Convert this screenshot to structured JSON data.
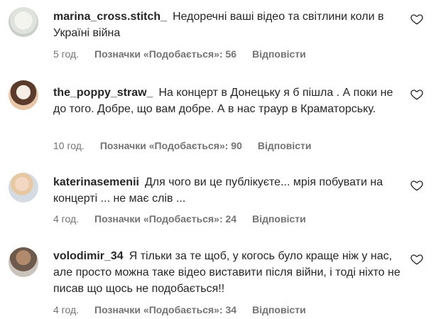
{
  "comments": [
    {
      "username": "marina_cross.stitch_",
      "text": "Недоречні ваші відео та світлини коли в Україні війна",
      "time": "5 год.",
      "likes": "Позначки «Подобається»: 56",
      "reply": "Відповісти"
    },
    {
      "username": "the_poppy_straw_",
      "text": "На концерт в Донецьку я б пішла . А поки не до того. Добре, що вам добре. А в нас траур в Краматорську.",
      "time": "10 год.",
      "likes": "Позначки «Подобається»: 90",
      "reply": "Відповісти"
    },
    {
      "username": "katerinasemenii",
      "text": "Для чого ви це публікуєте... мрія побувати на концерті ... не має слів ...",
      "time": "4 год.",
      "likes": "Позначки «Подобається»: 24",
      "reply": "Відповісти"
    },
    {
      "username": "volodimir_34",
      "text": "Я тільки за те щоб, у когось було краще ніж у нас, але просто можна таке відео виставити після війни, і тоді ніхто не писав що щось не подобається!!",
      "time": "4 год.",
      "likes": "Позначки «Подобається»: 34",
      "reply": "Відповісти"
    }
  ],
  "icons": {
    "like": "heart-outline-icon"
  }
}
